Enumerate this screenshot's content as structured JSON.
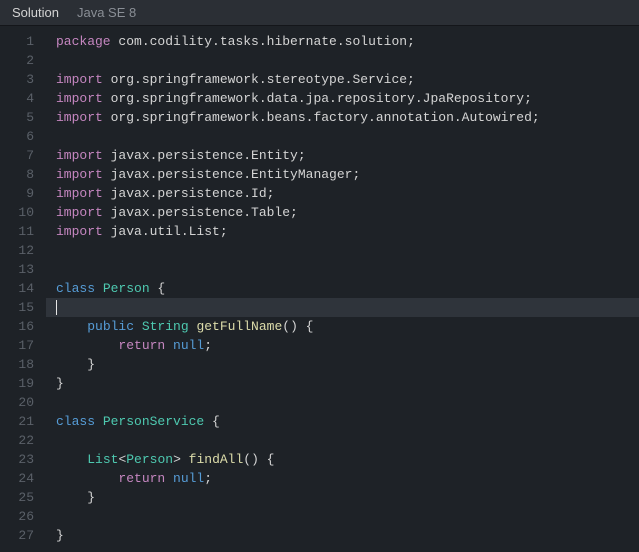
{
  "header": {
    "tab_solution": "Solution",
    "tab_runtime": "Java SE 8"
  },
  "code": {
    "lines": [
      {
        "n": 1,
        "tokens": [
          {
            "t": "package ",
            "c": "kw"
          },
          {
            "t": "com.codility.tasks.hibernate.solution;",
            "c": "pkg"
          }
        ]
      },
      {
        "n": 2,
        "tokens": []
      },
      {
        "n": 3,
        "tokens": [
          {
            "t": "import ",
            "c": "kw"
          },
          {
            "t": "org.springframework.stereotype.Service;",
            "c": "pkg"
          }
        ]
      },
      {
        "n": 4,
        "tokens": [
          {
            "t": "import ",
            "c": "kw"
          },
          {
            "t": "org.springframework.data.jpa.repository.JpaRepository;",
            "c": "pkg"
          }
        ]
      },
      {
        "n": 5,
        "tokens": [
          {
            "t": "import ",
            "c": "kw"
          },
          {
            "t": "org.springframework.beans.factory.annotation.Autowired;",
            "c": "pkg"
          }
        ]
      },
      {
        "n": 6,
        "tokens": []
      },
      {
        "n": 7,
        "tokens": [
          {
            "t": "import ",
            "c": "kw"
          },
          {
            "t": "javax.persistence.Entity;",
            "c": "pkg"
          }
        ]
      },
      {
        "n": 8,
        "tokens": [
          {
            "t": "import ",
            "c": "kw"
          },
          {
            "t": "javax.persistence.EntityManager;",
            "c": "pkg"
          }
        ]
      },
      {
        "n": 9,
        "tokens": [
          {
            "t": "import ",
            "c": "kw"
          },
          {
            "t": "javax.persistence.Id;",
            "c": "pkg"
          }
        ]
      },
      {
        "n": 10,
        "tokens": [
          {
            "t": "import ",
            "c": "kw"
          },
          {
            "t": "javax.persistence.Table;",
            "c": "pkg"
          }
        ]
      },
      {
        "n": 11,
        "tokens": [
          {
            "t": "import ",
            "c": "kw"
          },
          {
            "t": "java.util.List;",
            "c": "pkg"
          }
        ]
      },
      {
        "n": 12,
        "tokens": []
      },
      {
        "n": 13,
        "tokens": []
      },
      {
        "n": 14,
        "tokens": [
          {
            "t": "class ",
            "c": "kw2"
          },
          {
            "t": "Person ",
            "c": "cls"
          },
          {
            "t": "{",
            "c": "pun"
          }
        ]
      },
      {
        "n": 15,
        "tokens": [],
        "active": true,
        "cursor": true
      },
      {
        "n": 16,
        "tokens": [
          {
            "t": "    ",
            "c": "pun"
          },
          {
            "t": "public ",
            "c": "kw2"
          },
          {
            "t": "String ",
            "c": "type"
          },
          {
            "t": "getFullName",
            "c": "fn"
          },
          {
            "t": "() {",
            "c": "pun"
          }
        ]
      },
      {
        "n": 17,
        "tokens": [
          {
            "t": "        ",
            "c": "pun"
          },
          {
            "t": "return ",
            "c": "kw"
          },
          {
            "t": "null",
            "c": "kw2"
          },
          {
            "t": ";",
            "c": "pun"
          }
        ]
      },
      {
        "n": 18,
        "tokens": [
          {
            "t": "    }",
            "c": "pun"
          }
        ]
      },
      {
        "n": 19,
        "tokens": [
          {
            "t": "}",
            "c": "pun"
          }
        ]
      },
      {
        "n": 20,
        "tokens": []
      },
      {
        "n": 21,
        "tokens": [
          {
            "t": "class ",
            "c": "kw2"
          },
          {
            "t": "PersonService ",
            "c": "cls"
          },
          {
            "t": "{",
            "c": "pun"
          }
        ]
      },
      {
        "n": 22,
        "tokens": []
      },
      {
        "n": 23,
        "tokens": [
          {
            "t": "    ",
            "c": "pun"
          },
          {
            "t": "List",
            "c": "type"
          },
          {
            "t": "<",
            "c": "pun"
          },
          {
            "t": "Person",
            "c": "type"
          },
          {
            "t": "> ",
            "c": "pun"
          },
          {
            "t": "findAll",
            "c": "fn"
          },
          {
            "t": "() {",
            "c": "pun"
          }
        ]
      },
      {
        "n": 24,
        "tokens": [
          {
            "t": "        ",
            "c": "pun"
          },
          {
            "t": "return ",
            "c": "kw"
          },
          {
            "t": "null",
            "c": "kw2"
          },
          {
            "t": ";",
            "c": "pun"
          }
        ]
      },
      {
        "n": 25,
        "tokens": [
          {
            "t": "    }",
            "c": "pun"
          }
        ]
      },
      {
        "n": 26,
        "tokens": []
      },
      {
        "n": 27,
        "tokens": [
          {
            "t": "}",
            "c": "pun"
          }
        ]
      }
    ]
  }
}
